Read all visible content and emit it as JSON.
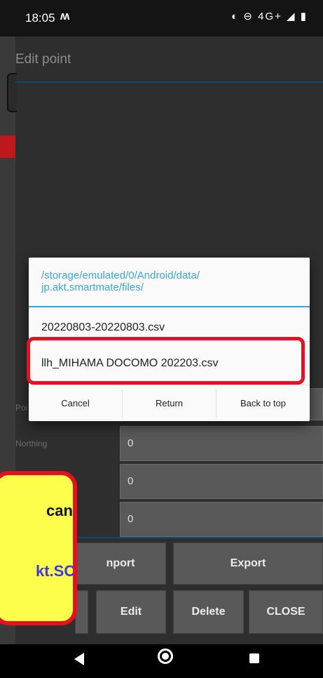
{
  "status": {
    "time": "18:05",
    "notif": "ʍ",
    "icons": "◐ ⊖ 4G+ ◢ ▮"
  },
  "header": {
    "title": "Edit point"
  },
  "side_labels": {
    "point": "Poi",
    "northing": "Northing"
  },
  "fields": [
    "0",
    "0",
    "0"
  ],
  "buttons": {
    "import": "nport",
    "export": "Export",
    "edit": "Edit",
    "delete": "Delete",
    "close": "CLOSE"
  },
  "dialog": {
    "path": "/storage/emulated/0/Android/data/\njp.akt.smartmate/files/",
    "items": [
      "20220803-20220803.csv",
      "llh_MIHAMA DOCOMO 202203.csv"
    ],
    "actions": {
      "cancel": "Cancel",
      "return": "Return",
      "back_to_top": "Back to top"
    }
  },
  "callout": {
    "line1": "can",
    "line2": "kt.SC"
  },
  "colors": {
    "accent": "#34a6dc",
    "highlight": "#e5111f",
    "callout_bg": "#fdfd4c"
  }
}
